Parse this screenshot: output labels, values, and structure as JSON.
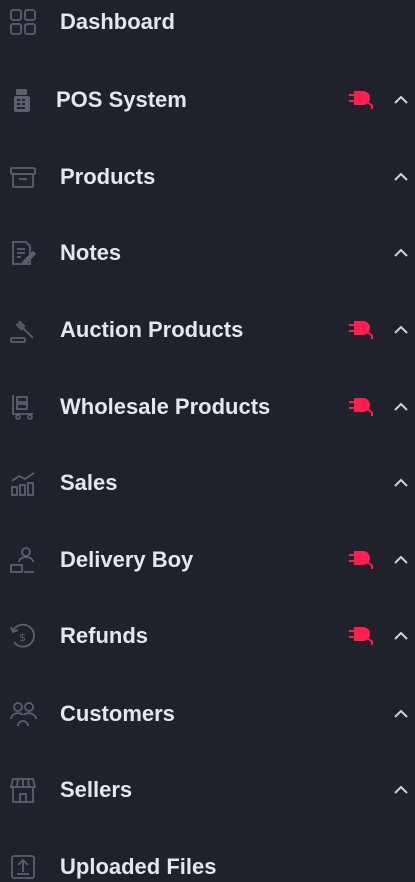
{
  "accent_color": "#ff1f4e",
  "sidebar": {
    "items": [
      {
        "label": "Dashboard",
        "icon": "dashboard-grid-icon",
        "addon": false,
        "chevron": false
      },
      {
        "label": "POS System",
        "icon": "pos-terminal-icon",
        "addon": true,
        "chevron": true
      },
      {
        "label": "Products",
        "icon": "box-icon",
        "addon": false,
        "chevron": true
      },
      {
        "label": "Notes",
        "icon": "note-edit-icon",
        "addon": false,
        "chevron": true
      },
      {
        "label": "Auction Products",
        "icon": "auction-gavel-icon",
        "addon": true,
        "chevron": true
      },
      {
        "label": "Wholesale Products",
        "icon": "wholesale-cart-icon",
        "addon": true,
        "chevron": true
      },
      {
        "label": "Sales",
        "icon": "sales-chart-icon",
        "addon": false,
        "chevron": true
      },
      {
        "label": "Delivery Boy",
        "icon": "delivery-person-icon",
        "addon": true,
        "chevron": true
      },
      {
        "label": "Refunds",
        "icon": "refund-coin-icon",
        "addon": true,
        "chevron": true
      },
      {
        "label": "Customers",
        "icon": "customers-group-icon",
        "addon": false,
        "chevron": true
      },
      {
        "label": "Sellers",
        "icon": "seller-shop-icon",
        "addon": false,
        "chevron": true
      },
      {
        "label": "Uploaded Files",
        "icon": "upload-file-icon",
        "addon": false,
        "chevron": false
      }
    ]
  }
}
